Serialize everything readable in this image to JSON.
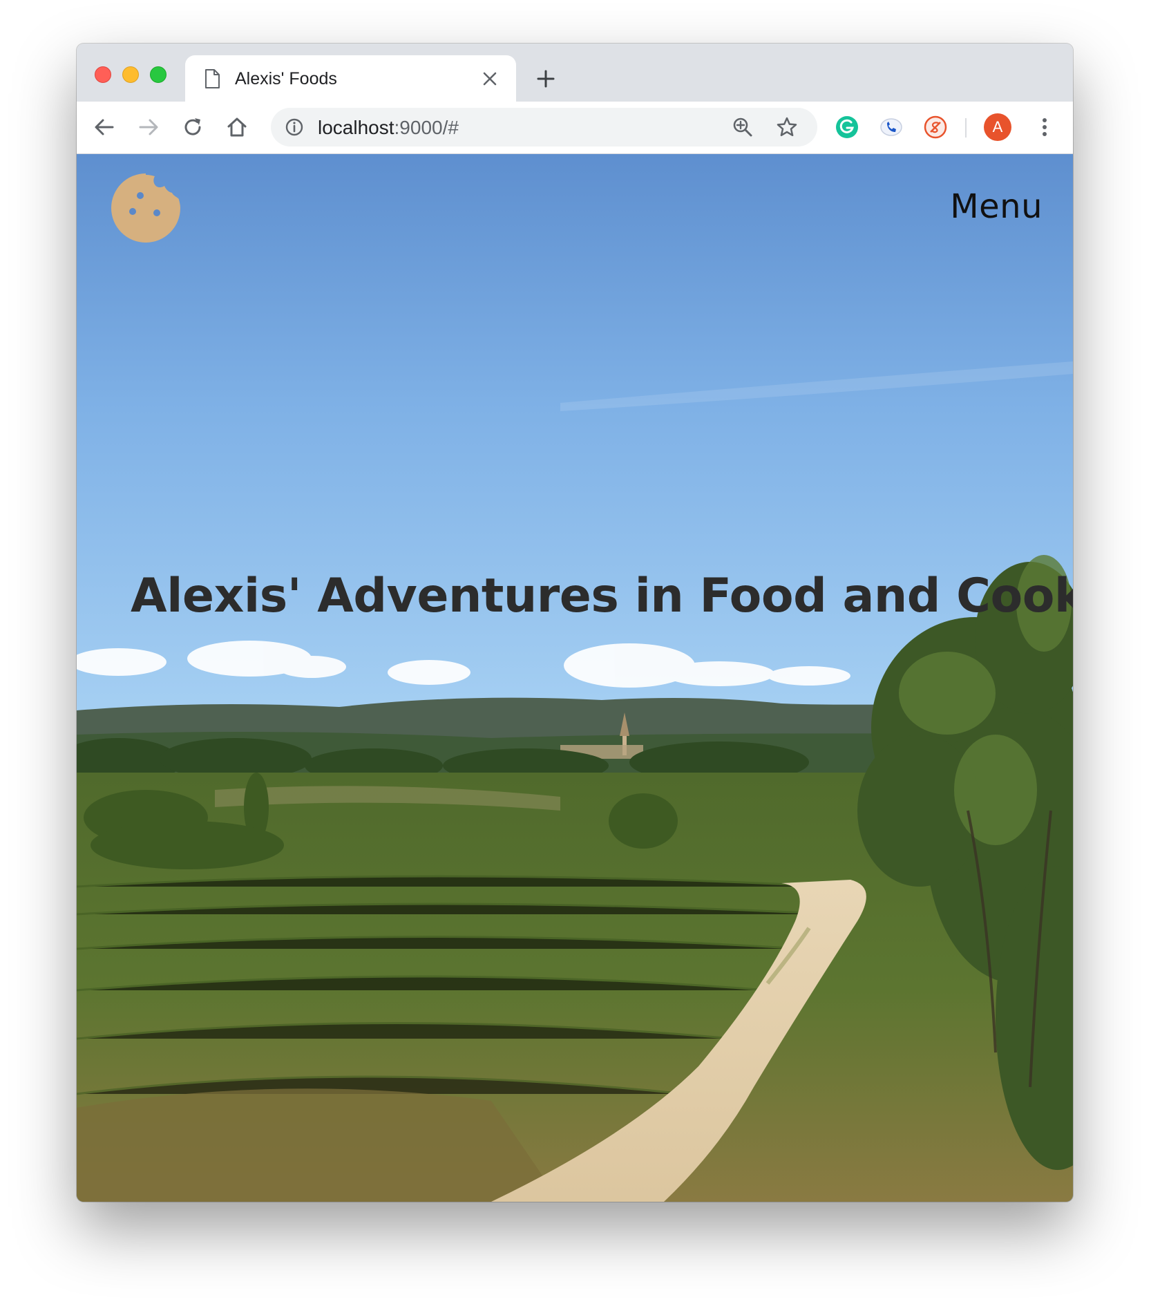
{
  "browser": {
    "tab": {
      "title": "Alexis' Foods",
      "page_icon": "document-icon",
      "close_icon": "close-icon"
    },
    "new_tab_icon": "plus-icon",
    "nav": {
      "back_icon": "arrow-left-icon",
      "forward_icon": "arrow-right-icon",
      "reload_icon": "reload-icon",
      "home_icon": "home-icon"
    },
    "omnibox": {
      "info_icon": "info-icon",
      "url_host": "localhost",
      "url_rest": ":9000/#",
      "zoom_icon": "zoom-icon",
      "bookmark_icon": "star-icon"
    },
    "extensions": [
      {
        "name": "grammarly-extension-icon",
        "color": "#15c39a",
        "glyph": "G"
      },
      {
        "name": "phone-extension-icon",
        "color": "#4285f4"
      },
      {
        "name": "shield-extension-icon",
        "color": "#e8532c"
      }
    ],
    "profile": {
      "initial": "A",
      "color": "#e8532c"
    },
    "menu_icon": "more-vert-icon"
  },
  "page": {
    "logo_icon": "cookie-icon",
    "logo_color": "#d6b07f",
    "menu_label": "Menu",
    "hero_title": "Alexis' Adventures in Food and Cooking"
  }
}
